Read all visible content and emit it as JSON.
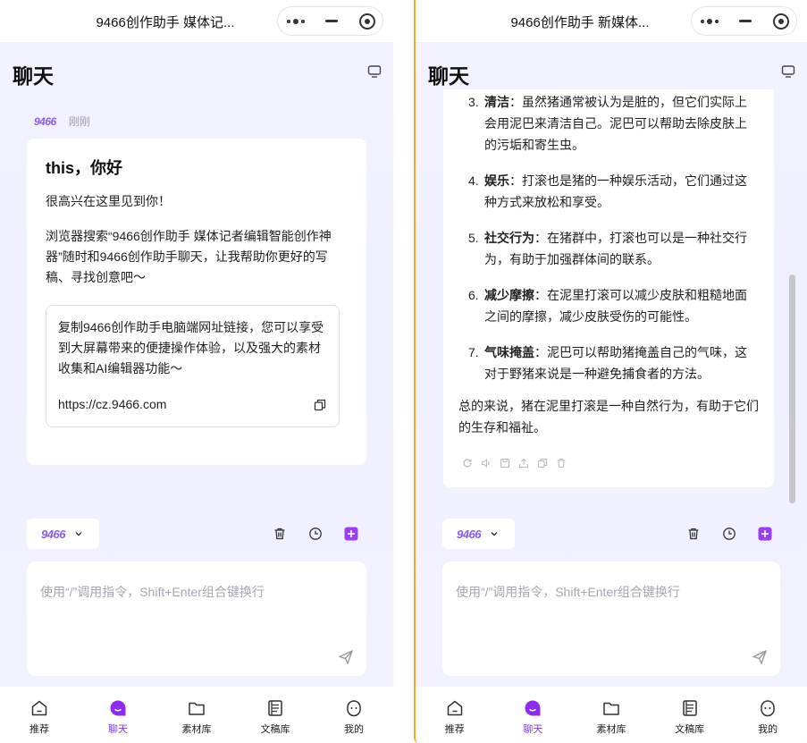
{
  "left": {
    "window_title": "9466创作助手 媒体记...",
    "header_title": "聊天",
    "message": {
      "sender": "9466",
      "time": "刚刚",
      "greeting": "this，你好",
      "line1": "很高兴在这里见到你！",
      "paragraph": "浏览器搜索“9466创作助手 媒体记者编辑智能创作神器”随时和9466创作助手聊天，让我帮助你更好的写稿、寻找创意吧～",
      "link_text": "复制9466创作助手电脑端网址链接，您可以享受到大屏幕带来的便捷操作体验，以及强大的素材收集和AI编辑器功能～",
      "link_url": "https://cz.9466.com"
    }
  },
  "right": {
    "window_title": "9466创作助手 新媒体...",
    "header_title": "聊天",
    "items": [
      {
        "num": "3.",
        "bold": "清洁",
        "text": "：虽然猪通常被认为是脏的，但它们实际上会用泥巴来清洁自己。泥巴可以帮助去除皮肤上的污垢和寄生虫。"
      },
      {
        "num": "4.",
        "bold": "娱乐",
        "text": "：打滚也是猪的一种娱乐活动，它们通过这种方式来放松和享受。"
      },
      {
        "num": "5.",
        "bold": "社交行为",
        "text": "：在猪群中，打滚也可以是一种社交行为，有助于加强群体间的联系。"
      },
      {
        "num": "6.",
        "bold": "减少摩擦",
        "text": "：在泥里打滚可以减少皮肤和粗糙地面之间的摩擦，减少皮肤受伤的可能性。"
      },
      {
        "num": "7.",
        "bold": "气味掩盖",
        "text": "：泥巴可以帮助猪掩盖自己的气味，这对于野猪来说是一种避免捕食者的方法。"
      }
    ],
    "summary": "总的来说，猪在泥里打滚是一种自然行为，有助于它们的生存和福祉。"
  },
  "composer": {
    "model": "9466",
    "placeholder": "使用“/”调用指令，Shift+Enter组合键换行"
  },
  "nav": [
    "推荐",
    "聊天",
    "素材库",
    "文稿库",
    "我的"
  ],
  "colors": {
    "accent": "#7c3aed",
    "brand": "#8a5cf6",
    "panel_bg": "#eef0ff"
  }
}
